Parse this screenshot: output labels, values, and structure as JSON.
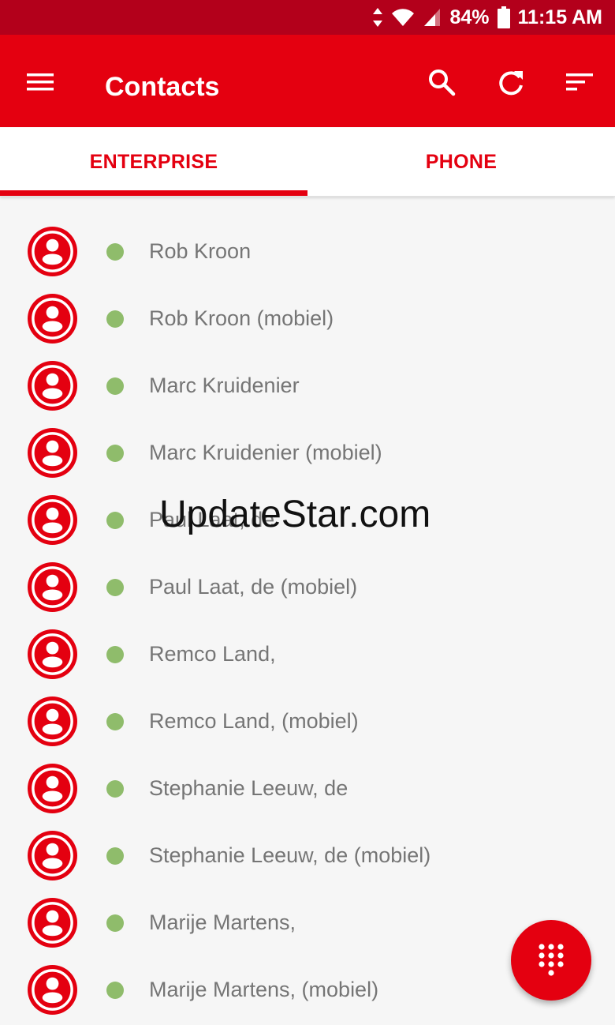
{
  "status_bar": {
    "battery": "84%",
    "time": "11:15 AM",
    "icons": [
      "data-arrows-icon",
      "wifi-icon",
      "signal-icon",
      "battery-icon"
    ]
  },
  "app_bar": {
    "title": "Contacts",
    "icons": [
      "menu-icon",
      "search-icon",
      "refresh-icon",
      "sort-icon"
    ],
    "color": "#e40010"
  },
  "tabs": [
    {
      "label": "ENTERPRISE",
      "selected": true
    },
    {
      "label": "PHONE",
      "selected": false
    }
  ],
  "contacts": [
    {
      "name": "Rob Kroon",
      "status": "available"
    },
    {
      "name": "Rob Kroon (mobiel)",
      "status": "available"
    },
    {
      "name": "Marc Kruidenier",
      "status": "available"
    },
    {
      "name": "Marc Kruidenier (mobiel)",
      "status": "available"
    },
    {
      "name": "Paul Laat, de",
      "status": "available"
    },
    {
      "name": "Paul Laat, de (mobiel)",
      "status": "available"
    },
    {
      "name": "Remco Land,",
      "status": "available"
    },
    {
      "name": "Remco Land, (mobiel)",
      "status": "available"
    },
    {
      "name": "Stephanie Leeuw, de",
      "status": "available"
    },
    {
      "name": "Stephanie Leeuw, de (mobiel)",
      "status": "available"
    },
    {
      "name": "Marije Martens,",
      "status": "available"
    },
    {
      "name": "Marije Martens, (mobiel)",
      "status": "available"
    }
  ],
  "watermark": "UpdateStar.com",
  "fab": {
    "icon": "dialpad-icon"
  },
  "colors": {
    "accent": "#e40010",
    "status_bar": "#b3001b",
    "presence_available": "#8fbc6b"
  }
}
